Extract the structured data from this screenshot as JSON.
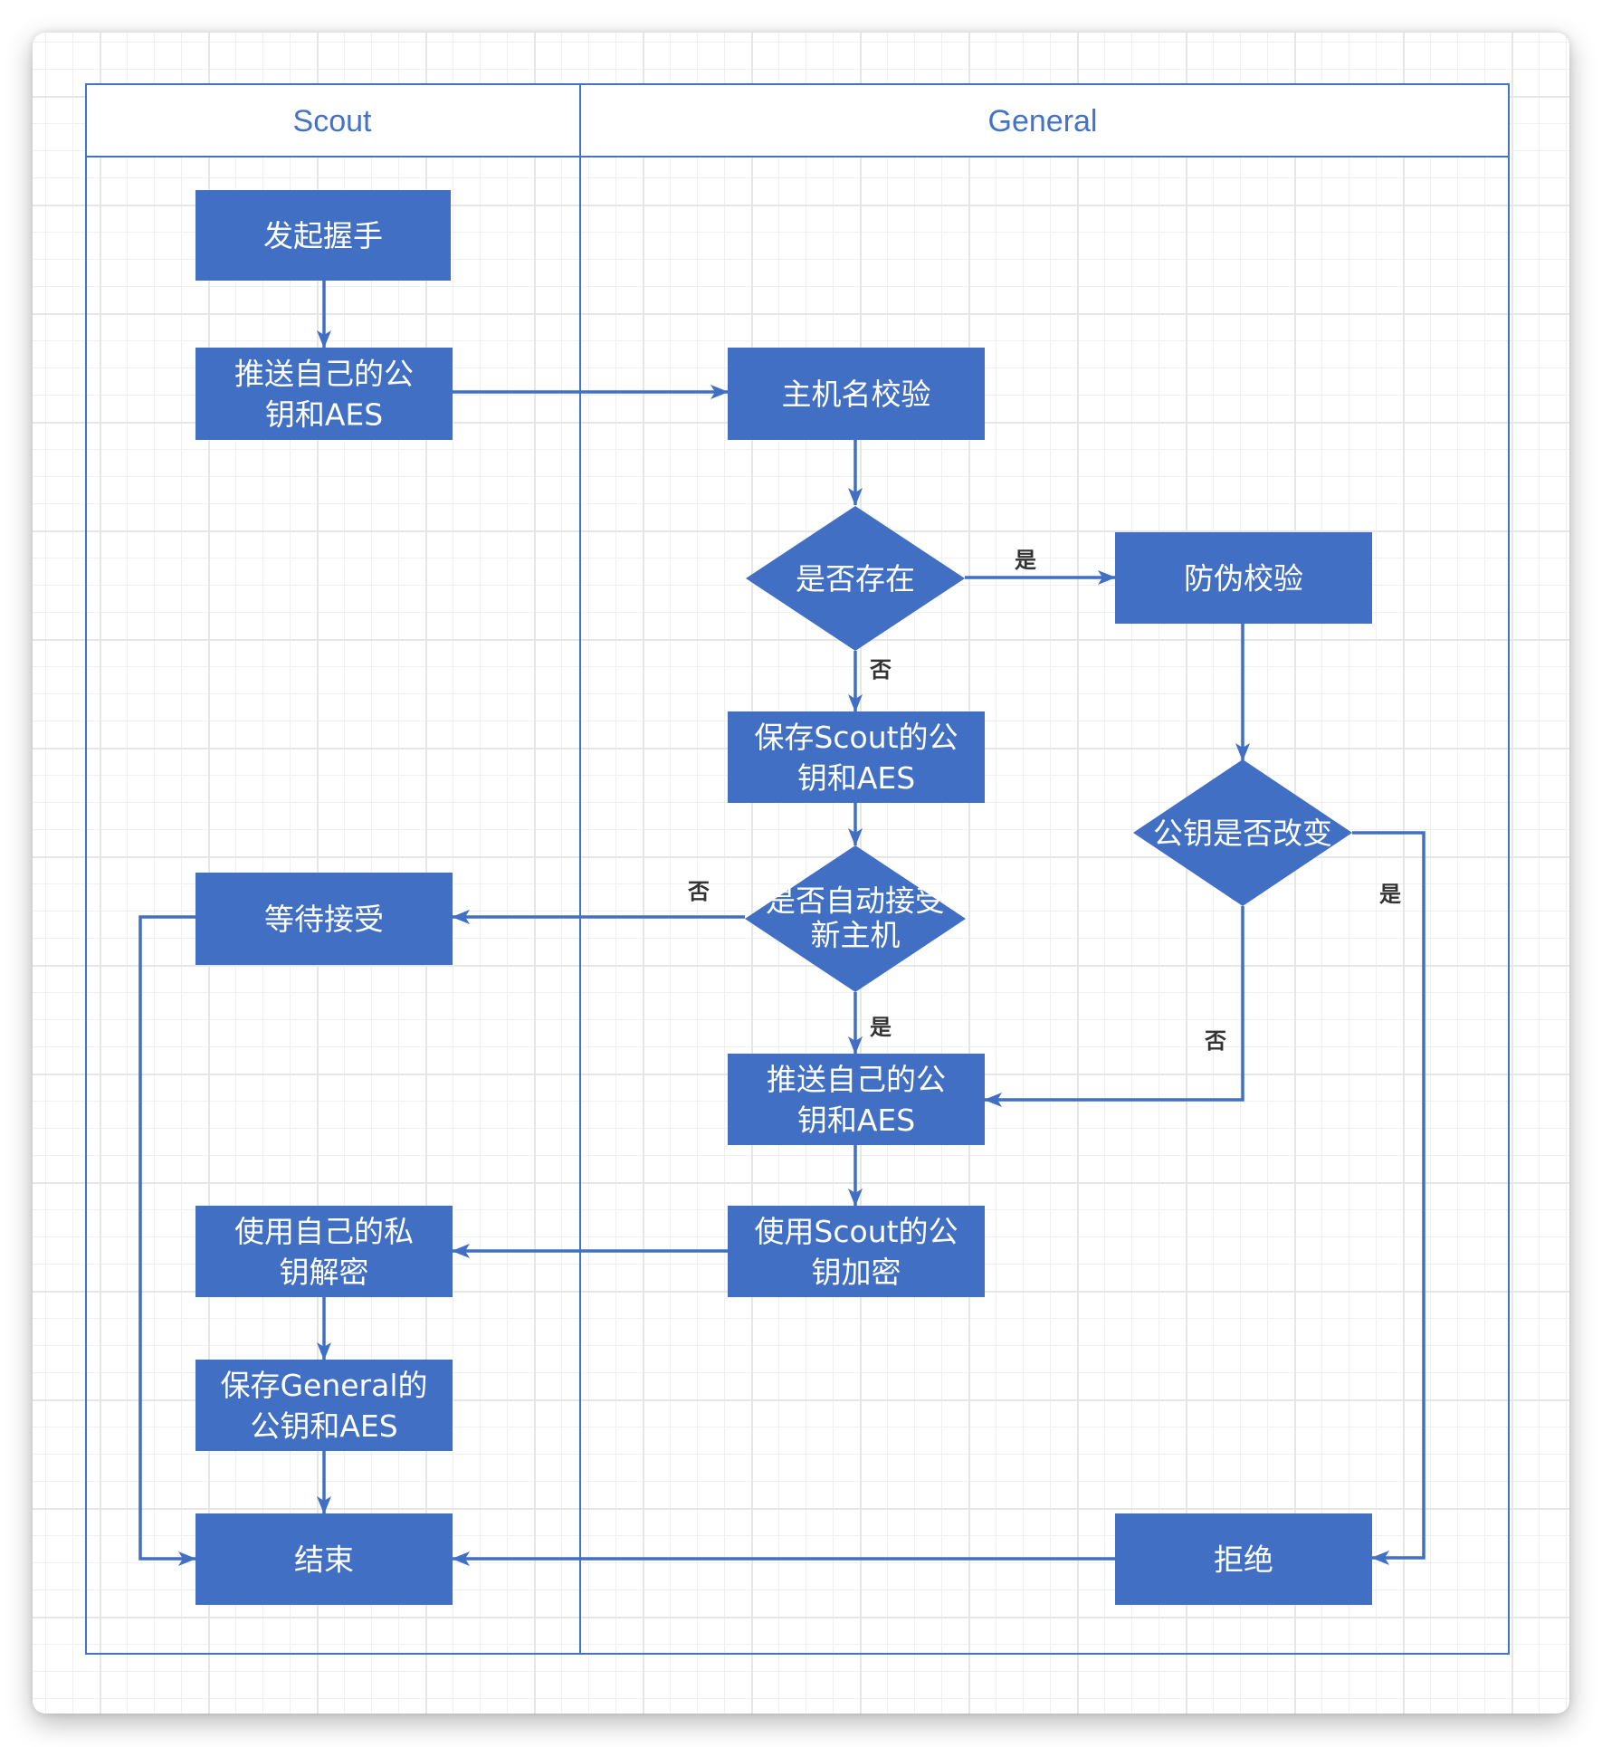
{
  "diagram": {
    "type": "swimlane-flowchart",
    "colors": {
      "node_fill": "#416fc4",
      "lane_stroke": "#4472c4",
      "edge": "#416fc4",
      "label": "#333333"
    },
    "lanes": [
      {
        "id": "scout",
        "title": "Scout"
      },
      {
        "id": "general",
        "title": "General"
      }
    ],
    "nodes": [
      {
        "id": "n1",
        "lane": "scout",
        "shape": "rect",
        "lines": [
          "发起握手"
        ]
      },
      {
        "id": "n2",
        "lane": "scout",
        "shape": "rect",
        "lines": [
          "推送自己的公",
          "钥和AES"
        ]
      },
      {
        "id": "n3",
        "lane": "general",
        "shape": "rect",
        "lines": [
          "主机名校验"
        ]
      },
      {
        "id": "d1",
        "lane": "general",
        "shape": "diamond",
        "lines": [
          "是否存在"
        ]
      },
      {
        "id": "n4",
        "lane": "general",
        "shape": "rect",
        "lines": [
          "防伪校验"
        ]
      },
      {
        "id": "n5",
        "lane": "general",
        "shape": "rect",
        "lines": [
          "保存Scout的公",
          "钥和AES"
        ]
      },
      {
        "id": "d3",
        "lane": "general",
        "shape": "diamond",
        "lines": [
          "公钥是否改变"
        ]
      },
      {
        "id": "d2",
        "lane": "general",
        "shape": "diamond",
        "lines": [
          "是否自动接受",
          "新主机"
        ]
      },
      {
        "id": "n6",
        "lane": "scout",
        "shape": "rect",
        "lines": [
          "等待接受"
        ]
      },
      {
        "id": "n7",
        "lane": "general",
        "shape": "rect",
        "lines": [
          "推送自己的公",
          "钥和AES"
        ]
      },
      {
        "id": "n8",
        "lane": "general",
        "shape": "rect",
        "lines": [
          "使用Scout的公",
          "钥加密"
        ]
      },
      {
        "id": "n9",
        "lane": "scout",
        "shape": "rect",
        "lines": [
          "使用自己的私",
          "钥解密"
        ]
      },
      {
        "id": "n10",
        "lane": "scout",
        "shape": "rect",
        "lines": [
          "保存General的",
          "公钥和AES"
        ]
      },
      {
        "id": "n11",
        "lane": "scout",
        "shape": "rect",
        "lines": [
          "结束"
        ]
      },
      {
        "id": "n12",
        "lane": "general",
        "shape": "rect",
        "lines": [
          "拒绝"
        ]
      }
    ],
    "edges": [
      {
        "from": "n1",
        "to": "n2",
        "label": ""
      },
      {
        "from": "n2",
        "to": "n3",
        "label": ""
      },
      {
        "from": "n3",
        "to": "d1",
        "label": ""
      },
      {
        "from": "d1",
        "to": "n4",
        "label": "是"
      },
      {
        "from": "d1",
        "to": "n5",
        "label": "否"
      },
      {
        "from": "n4",
        "to": "d3",
        "label": ""
      },
      {
        "from": "n5",
        "to": "d2",
        "label": ""
      },
      {
        "from": "d2",
        "to": "n6",
        "label": "否"
      },
      {
        "from": "d2",
        "to": "n7",
        "label": "是"
      },
      {
        "from": "d3",
        "to": "n7",
        "label": "否"
      },
      {
        "from": "d3",
        "to": "n12",
        "label": "是"
      },
      {
        "from": "n7",
        "to": "n8",
        "label": ""
      },
      {
        "from": "n8",
        "to": "n9",
        "label": ""
      },
      {
        "from": "n9",
        "to": "n10",
        "label": ""
      },
      {
        "from": "n10",
        "to": "n11",
        "label": ""
      },
      {
        "from": "n6",
        "to": "n11",
        "label": ""
      },
      {
        "from": "n12",
        "to": "n11",
        "label": ""
      }
    ]
  }
}
